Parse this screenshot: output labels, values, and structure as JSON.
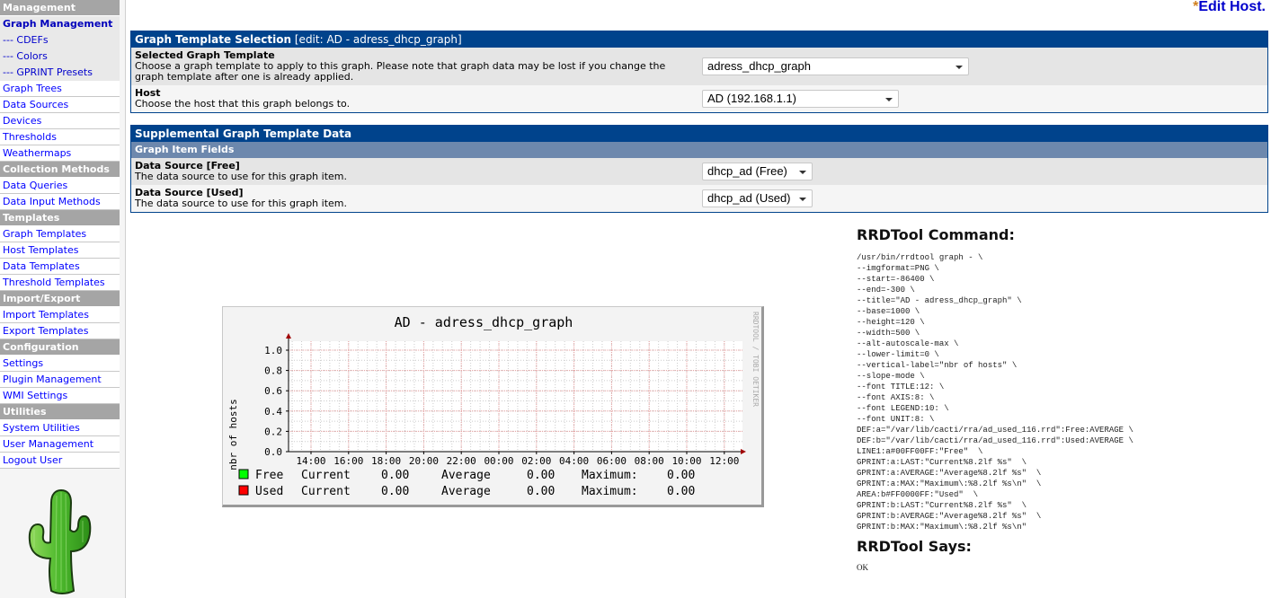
{
  "sidebar": {
    "sections": [
      {
        "header": "Management",
        "items": [
          {
            "label": "Graph Management",
            "state": "active"
          },
          {
            "label": "--- CDEFs",
            "state": "sub"
          },
          {
            "label": "--- Colors",
            "state": "sub"
          },
          {
            "label": "--- GPRINT Presets",
            "state": "sub"
          },
          {
            "label": "Graph Trees"
          },
          {
            "label": "Data Sources"
          },
          {
            "label": "Devices"
          },
          {
            "label": "Thresholds"
          },
          {
            "label": "Weathermaps"
          }
        ]
      },
      {
        "header": "Collection Methods",
        "items": [
          {
            "label": "Data Queries"
          },
          {
            "label": "Data Input Methods"
          }
        ]
      },
      {
        "header": "Templates",
        "items": [
          {
            "label": "Graph Templates"
          },
          {
            "label": "Host Templates"
          },
          {
            "label": "Data Templates"
          },
          {
            "label": "Threshold Templates"
          }
        ]
      },
      {
        "header": "Import/Export",
        "items": [
          {
            "label": "Import Templates"
          },
          {
            "label": "Export Templates"
          }
        ]
      },
      {
        "header": "Configuration",
        "items": [
          {
            "label": "Settings"
          },
          {
            "label": "Plugin Management"
          },
          {
            "label": "WMI Settings"
          }
        ]
      },
      {
        "header": "Utilities",
        "items": [
          {
            "label": "System Utilities"
          },
          {
            "label": "User Management"
          },
          {
            "label": "Logout User"
          }
        ]
      }
    ],
    "logo": "cactus-logo"
  },
  "top": {
    "edit_host_star": "*",
    "edit_host_label": "Edit Host."
  },
  "template_panel": {
    "title": "Graph Template Selection",
    "title_suffix": "[edit: AD - adress_dhcp_graph]",
    "rows": [
      {
        "label": "Selected Graph Template",
        "desc": "Choose a graph template to apply to this graph. Please note that graph data may be lost if you change the graph template after one is already applied.",
        "value": "adress_dhcp_graph"
      },
      {
        "label": "Host",
        "desc": "Choose the host that this graph belongs to.",
        "value": "AD (192.168.1.1)"
      }
    ]
  },
  "supplemental_panel": {
    "title": "Supplemental Graph Template Data",
    "subheading": "Graph Item Fields",
    "rows": [
      {
        "label": "Data Source [Free]",
        "desc": "The data source to use for this graph item.",
        "value": "dhcp_ad (Free)"
      },
      {
        "label": "Data Source [Used]",
        "desc": "The data source to use for this graph item.",
        "value": "dhcp_ad (Used)"
      }
    ]
  },
  "graph": {
    "watermark": "RRDTOOL / TOBI OETIKER",
    "colors": {
      "free": "#00FF00",
      "used": "#FF0000",
      "grid_major": "#e8a0a0",
      "grid_minor": "#cccccc",
      "axis": "#800000"
    },
    "legend": [
      {
        "name": "Free",
        "current_label": "Current",
        "current": "0.00",
        "average_label": "Average",
        "average": "0.00",
        "maximum_label": "Maximum:",
        "maximum": "0.00"
      },
      {
        "name": "Used",
        "current_label": "Current",
        "current": "0.00",
        "average_label": "Average",
        "average": "0.00",
        "maximum_label": "Maximum:",
        "maximum": "0.00"
      }
    ]
  },
  "chart_data": {
    "type": "area",
    "title": "AD - adress_dhcp_graph",
    "xlabel": "",
    "ylabel": "nbr of hosts",
    "x_ticks": [
      "14:00",
      "16:00",
      "18:00",
      "20:00",
      "22:00",
      "00:00",
      "02:00",
      "04:00",
      "06:00",
      "08:00",
      "10:00",
      "12:00"
    ],
    "y_ticks": [
      "0.0",
      "0.2",
      "0.4",
      "0.6",
      "0.8",
      "1.0"
    ],
    "ylim": [
      0,
      1.0
    ],
    "grid": true,
    "legend_position": "bottom",
    "series": [
      {
        "name": "Free",
        "style": "line",
        "color": "#00FF00",
        "values": []
      },
      {
        "name": "Used",
        "style": "area",
        "color": "#FF0000",
        "values": []
      }
    ]
  },
  "rrdtool": {
    "command_heading": "RRDTool Command:",
    "command_lines": [
      "/usr/bin/rrdtool graph - \\",
      "--imgformat=PNG \\",
      "--start=-86400 \\",
      "--end=-300 \\",
      "--title=\"AD - adress_dhcp_graph\" \\",
      "--base=1000 \\",
      "--height=120 \\",
      "--width=500 \\",
      "--alt-autoscale-max \\",
      "--lower-limit=0 \\",
      "--vertical-label=\"nbr of hosts\" \\",
      "--slope-mode \\",
      "--font TITLE:12: \\",
      "--font AXIS:8: \\",
      "--font LEGEND:10: \\",
      "--font UNIT:8: \\",
      "DEF:a=\"/var/lib/cacti/rra/ad_used_116.rrd\":Free:AVERAGE \\",
      "DEF:b=\"/var/lib/cacti/rra/ad_used_116.rrd\":Used:AVERAGE \\",
      "LINE1:a#00FF00FF:\"Free\"  \\",
      "GPRINT:a:LAST:\"Current%8.2lf %s\"  \\",
      "GPRINT:a:AVERAGE:\"Average%8.2lf %s\"  \\",
      "GPRINT:a:MAX:\"Maximum\\:%8.2lf %s\\n\"  \\",
      "AREA:b#FF0000FF:\"Used\"  \\",
      "GPRINT:b:LAST:\"Current%8.2lf %s\"  \\",
      "GPRINT:b:AVERAGE:\"Average%8.2lf %s\"  \\",
      "GPRINT:b:MAX:\"Maximum\\:%8.2lf %s\\n\""
    ],
    "says_heading": "RRDTool Says:",
    "says": "OK"
  }
}
